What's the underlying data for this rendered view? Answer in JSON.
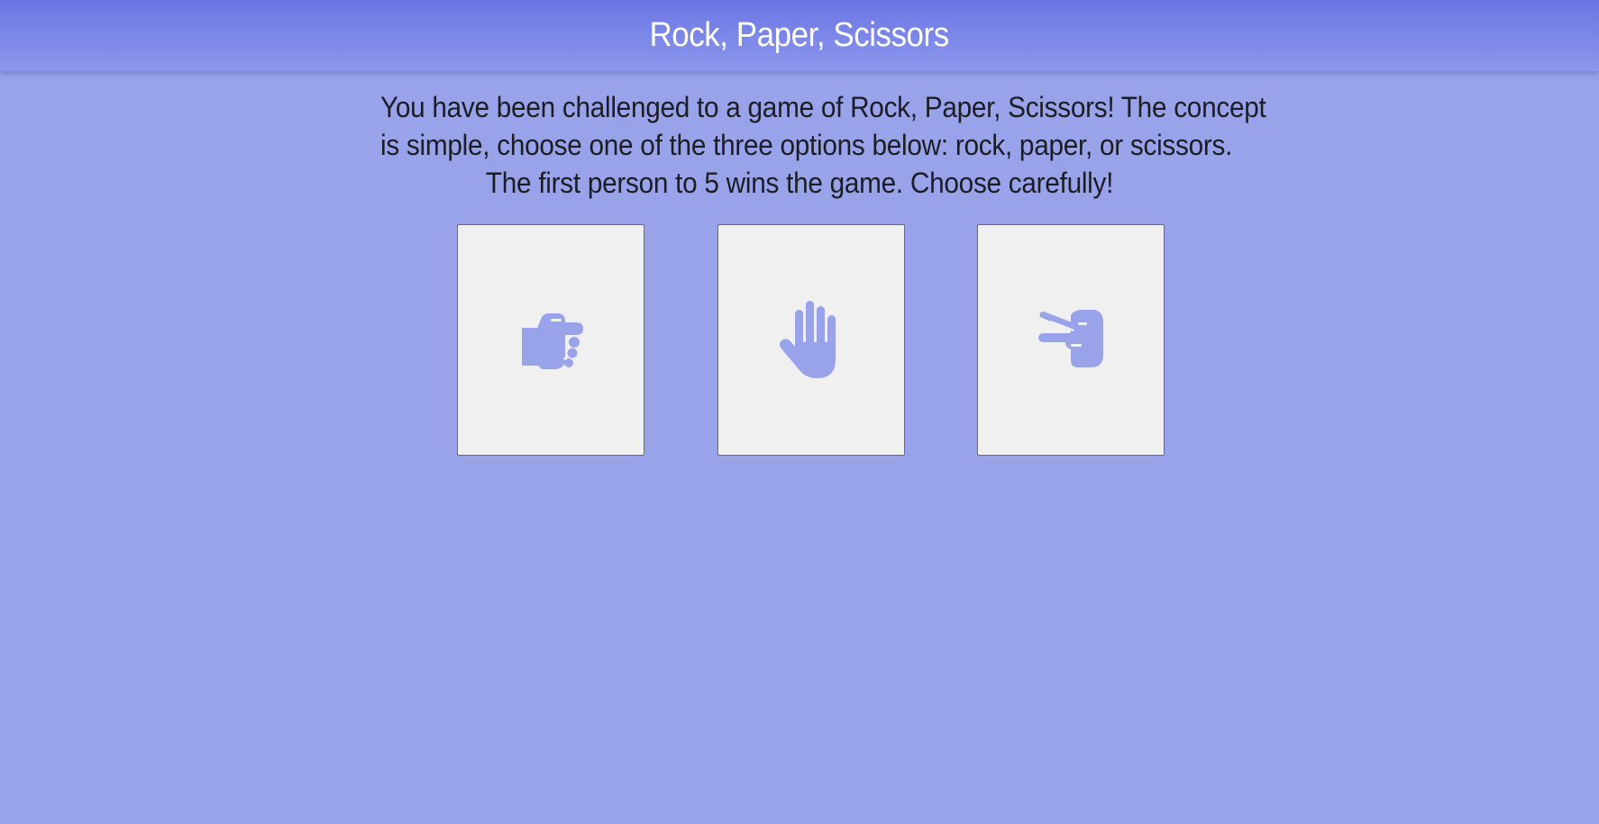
{
  "header": {
    "title": "Rock, Paper, Scissors"
  },
  "intro": {
    "lines": [
      "You have been challenged to a game of Rock, Paper, Scissors! The concept",
      "is simple, choose one of the three options below: rock, paper, or scissors.",
      "The first person to 5 wins the game. Choose carefully!"
    ]
  },
  "choices": [
    {
      "id": "rock",
      "icon": "hand-rock-icon"
    },
    {
      "id": "paper",
      "icon": "hand-paper-icon"
    },
    {
      "id": "scissors",
      "icon": "hand-scissors-icon"
    }
  ],
  "colors": {
    "background": "#99a3ea",
    "header_top": "#6a76e3",
    "header_bottom": "#8c97ec",
    "card": "#f0f0f0",
    "icon": "#99a3ea",
    "title_text": "#ffffff",
    "body_text": "#1d1d26"
  }
}
